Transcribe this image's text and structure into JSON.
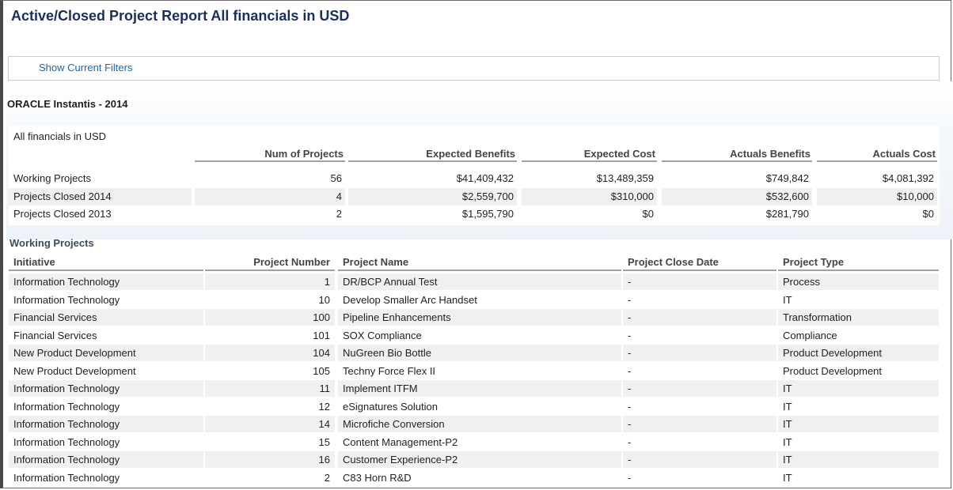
{
  "report": {
    "title": "Active/Closed Project Report All financials in USD",
    "filters_link": "Show Current Filters",
    "section_heading": "ORACLE Instantis - 2014"
  },
  "summary": {
    "caption": "All financials in USD",
    "columns": [
      "Num of Projects",
      "Expected Benefits",
      "Expected Cost",
      "Actuals Benefits",
      "Actuals Cost"
    ],
    "rows": [
      {
        "label": "Working Projects",
        "values": [
          "56",
          "$41,409,432",
          "$13,489,359",
          "$749,842",
          "$4,081,392"
        ]
      },
      {
        "label": "Projects Closed 2014",
        "values": [
          "4",
          "$2,559,700",
          "$310,000",
          "$532,600",
          "$10,000"
        ]
      },
      {
        "label": "Projects Closed 2013",
        "values": [
          "2",
          "$1,595,790",
          "$0",
          "$281,790",
          "$0"
        ]
      }
    ]
  },
  "working_projects": {
    "heading": "Working Projects",
    "columns": [
      "Initiative",
      "Project Number",
      "Project Name",
      "Project Close Date",
      "Project Type"
    ],
    "rows": [
      [
        "Information Technology",
        "1",
        "DR/BCP Annual Test",
        "-",
        "Process"
      ],
      [
        "Information Technology",
        "10",
        "Develop Smaller Arc Handset",
        "-",
        "IT"
      ],
      [
        "Financial Services",
        "100",
        "Pipeline Enhancements",
        "-",
        "Transformation"
      ],
      [
        "Financial Services",
        "101",
        "SOX Compliance",
        "-",
        "Compliance"
      ],
      [
        "New Product Development",
        "104",
        "NuGreen Bio Bottle",
        "-",
        "Product Development"
      ],
      [
        "New Product Development",
        "105",
        "Techny Force Flex II",
        "-",
        "Product Development"
      ],
      [
        "Information Technology",
        "11",
        "Implement ITFM",
        "-",
        "IT"
      ],
      [
        "Information Technology",
        "12",
        "eSignatures Solution",
        "-",
        "IT"
      ],
      [
        "Information Technology",
        "14",
        "Microfiche Conversion",
        "-",
        "IT"
      ],
      [
        "Information Technology",
        "15",
        "Content Management-P2",
        "-",
        "IT"
      ],
      [
        "Information Technology",
        "16",
        "Customer Experience-P2",
        "-",
        "IT"
      ],
      [
        "Information Technology",
        "2",
        "C83 Horn R&D",
        "-",
        "IT"
      ]
    ]
  }
}
